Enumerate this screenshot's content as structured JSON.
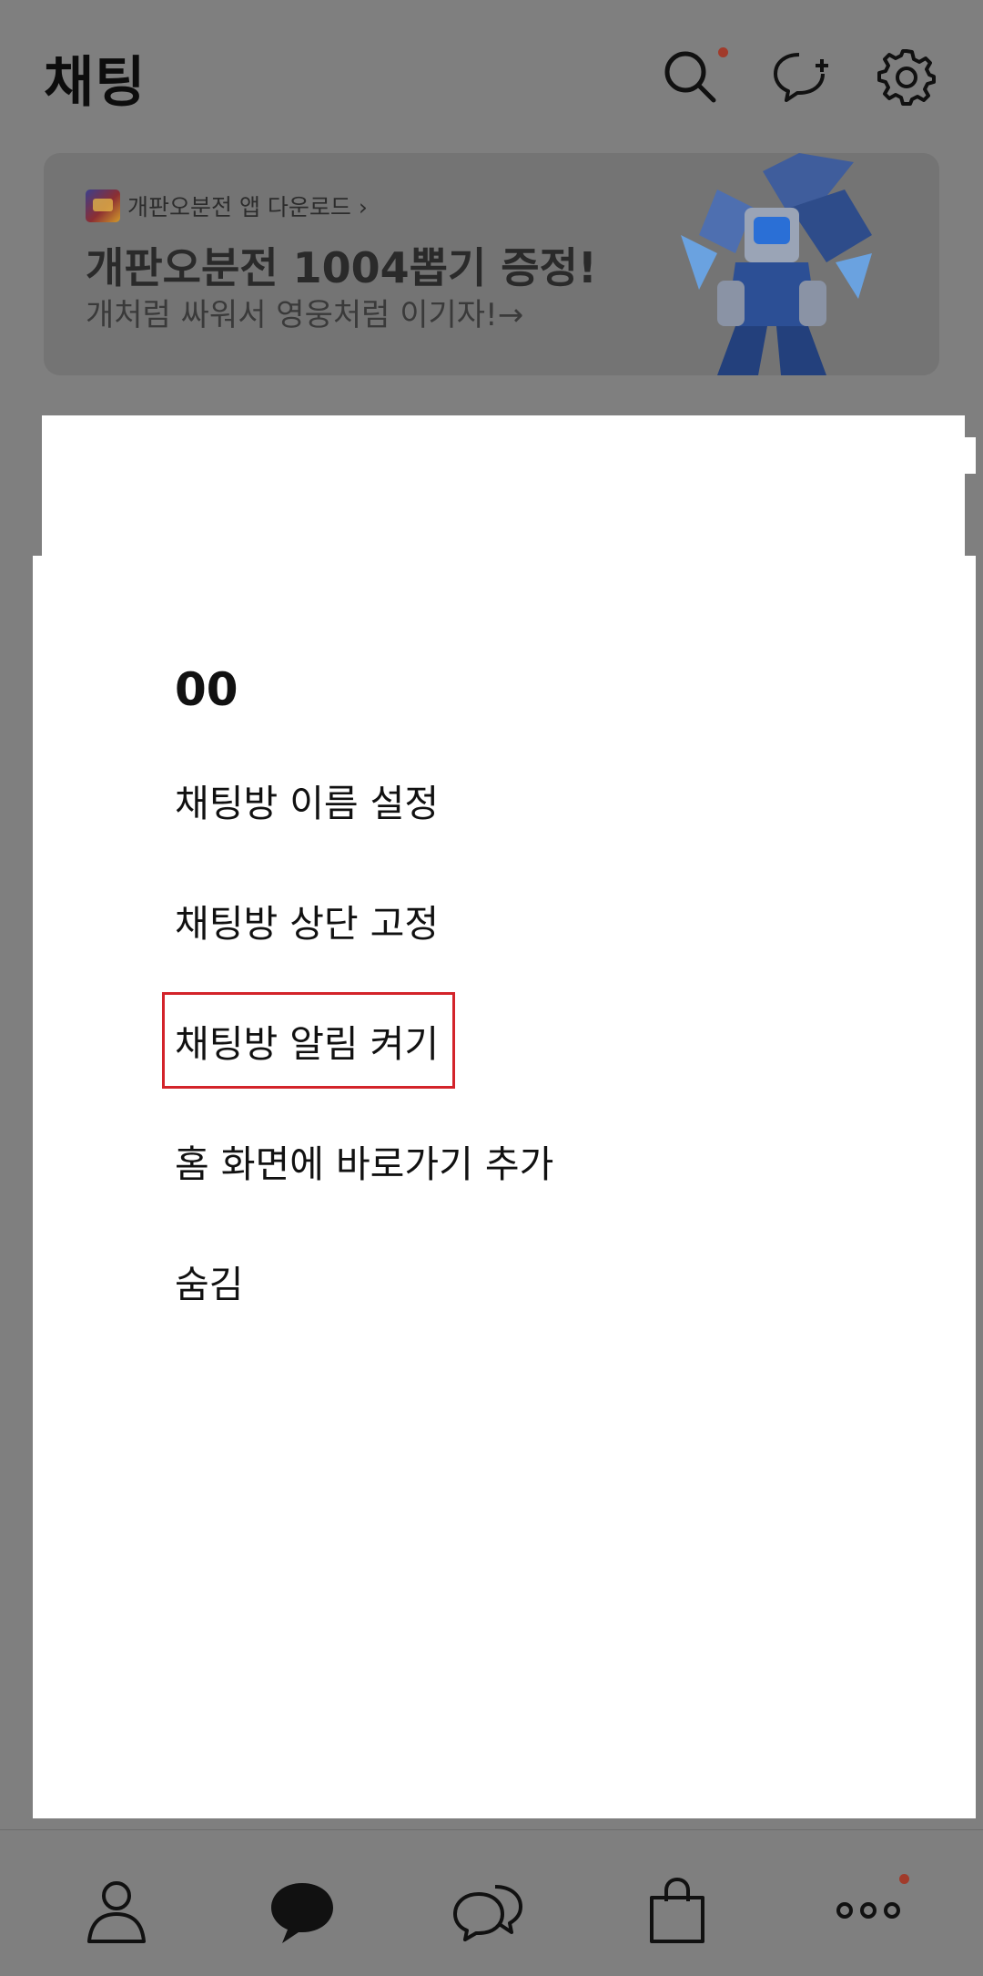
{
  "header": {
    "title": "채팅",
    "icons": [
      "search-icon",
      "new-chat-icon",
      "gear-icon"
    ],
    "notification_dot_color": "#a13b2b"
  },
  "banner": {
    "small_text": "개판오분전 앱 다운로드 ›",
    "headline": "개판오분전 1004뽑기 증정!",
    "subtext": "개처럼 싸워서 영웅처럼 이기자!→"
  },
  "menu": {
    "title": "00",
    "items": [
      {
        "label": "채팅방 이름 설정"
      },
      {
        "label": "채팅방 상단 고정"
      },
      {
        "label": "채팅방 알림 켜기"
      },
      {
        "label": "홈 화면에 바로가기 추가"
      },
      {
        "label": "숨김"
      }
    ],
    "highlight_color": "#d3232a"
  },
  "bottom_nav": {
    "items": [
      "friends-icon",
      "chats-icon",
      "open-chat-icon",
      "shopping-icon",
      "more-icon"
    ]
  }
}
